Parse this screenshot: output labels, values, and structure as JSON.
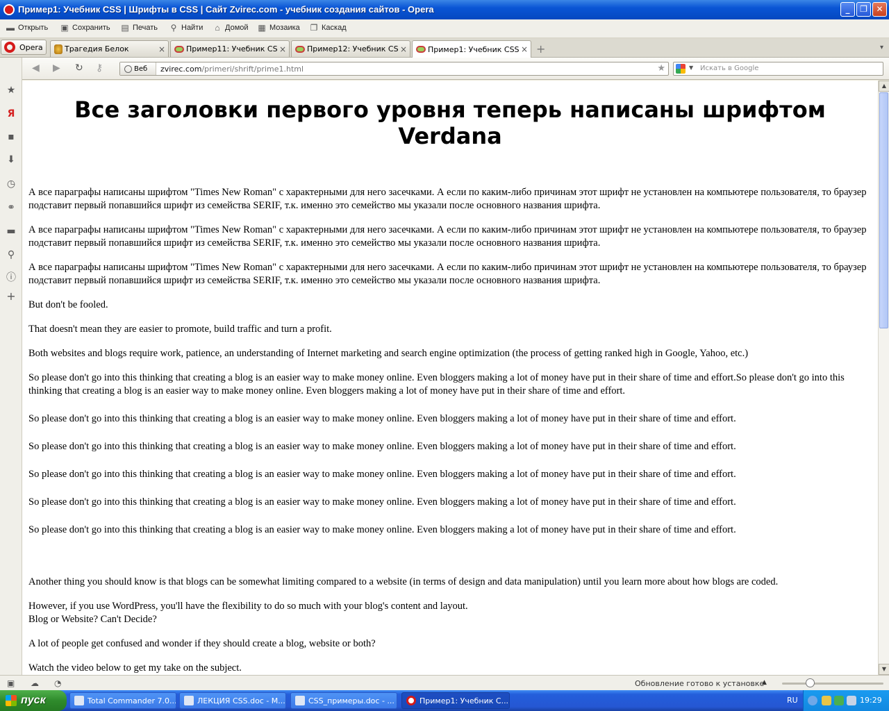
{
  "window": {
    "title": "Пример1: Учебник CSS | Шрифты в CSS | Сайт Zvirec.com - учебник создания сайтов - Opera",
    "minimize": "_",
    "maximize": "❐",
    "close": "✕"
  },
  "toolbar": {
    "items": [
      {
        "label": "Открыть",
        "icon": "folder-icon"
      },
      {
        "label": "Сохранить",
        "icon": "save-icon"
      },
      {
        "label": "Печать",
        "icon": "print-icon"
      },
      {
        "label": "Найти",
        "icon": "search-icon"
      },
      {
        "label": "Домой",
        "icon": "home-icon"
      },
      {
        "label": "Мозаика",
        "icon": "tile-icon"
      },
      {
        "label": "Каскад",
        "icon": "cascade-icon"
      }
    ]
  },
  "tabs": {
    "menu_label": "Opera",
    "items": [
      {
        "title": "Трагедия Белок",
        "active": false
      },
      {
        "title": "Пример11: Учебник CS...",
        "active": false
      },
      {
        "title": "Пример12: Учебник CS...",
        "active": false
      },
      {
        "title": "Пример1: Учебник CSS ...",
        "active": true
      }
    ],
    "close": "×",
    "add": "+",
    "list": "▾"
  },
  "address": {
    "web_label": "Веб",
    "host": "zvirec.com",
    "path": "/primeri/shrift/prime1.html",
    "search_placeholder": "Искать в Google"
  },
  "page": {
    "heading": "Все заголовки первого уровня теперь написаны шрифтом Verdana",
    "paragraphs": [
      "А все параграфы написаны шрифтом \"Times New Roman\" с характерными для него засечками. А если по каким-либо причинам этот шрифт не установлен на компьютере пользователя, то браузер подставит первый попавшийся шрифт из семейства SERIF, т.к. именно это семейство мы указали после основного названия шрифта.",
      "А все параграфы написаны шрифтом \"Times New Roman\" с характерными для него засечками. А если по каким-либо причинам этот шрифт не установлен на компьютере пользователя, то браузер подставит первый попавшийся шрифт из семейства SERIF, т.к. именно это семейство мы указали после основного названия шрифта.",
      "А все параграфы написаны шрифтом \"Times New Roman\" с характерными для него засечками. А если по каким-либо причинам этот шрифт не установлен на компьютере пользователя, то браузер подставит первый попавшийся шрифт из семейства SERIF, т.к. именно это семейство мы указали после основного названия шрифта.",
      "But don't be fooled.",
      "That doesn't mean they are easier to promote, build traffic and turn a profit.",
      "Both websites and blogs require work, patience, an understanding of Internet marketing and search engine optimization (the process of getting ranked high in Google, Yahoo, etc.)",
      "So please don't go into this thinking that creating a blog is an easier way to make money online. Even bloggers making a lot of money have put in their share of time and effort.So please don't go into this thinking that creating a blog is an easier way to make money online. Even bloggers making a lot of money have put in their share of time and effort.",
      "So please don't go into this thinking that creating a blog is an easier way to make money online. Even bloggers making a lot of money have put in their share of time and effort.",
      "So please don't go into this thinking that creating a blog is an easier way to make money online. Even bloggers making a lot of money have put in their share of time and effort.",
      "So please don't go into this thinking that creating a blog is an easier way to make money online. Even bloggers making a lot of money have put in their share of time and effort.",
      "So please don't go into this thinking that creating a blog is an easier way to make money online. Even bloggers making a lot of money have put in their share of time and effort.",
      "So please don't go into this thinking that creating a blog is an easier way to make money online. Even bloggers making a lot of money have put in their share of time and effort.",
      "Another thing you should know is that blogs can be somewhat limiting compared to a website (in terms of design and data manipulation) until you learn more about how blogs are coded.",
      "However, if you use WordPress, you'll have the flexibility to do so much with your blog's content and layout.",
      "Blog or Website? Can't Decide?",
      "A lot of people get confused and wonder if they should create a blog, website or both?",
      "Watch the video below to get my take on the subject."
    ]
  },
  "status": {
    "text": "Обновление готово к установке",
    "arrow": "▲"
  },
  "taskbar": {
    "start": "пуск",
    "tasks": [
      {
        "label": "Total Commander 7.0...",
        "active": false
      },
      {
        "label": "ЛЕКЦИЯ CSS.doc - M...",
        "active": false
      },
      {
        "label": "CSS_примеры.doc - ...",
        "active": false
      },
      {
        "label": "Пример1: Учебник С...",
        "active": true
      }
    ],
    "lang": "RU",
    "clock": "19:29"
  },
  "colors": {
    "titlebar": "#0a55d5",
    "accent_red": "#d41a1a",
    "taskbar": "#245edb",
    "start_green": "#2f8b2c"
  }
}
